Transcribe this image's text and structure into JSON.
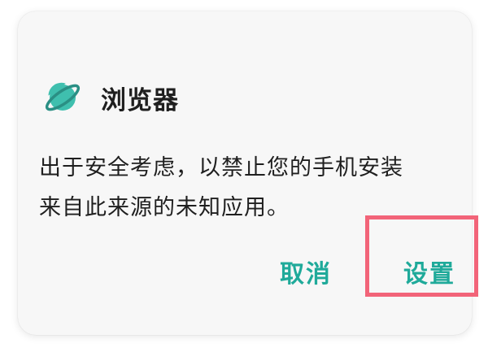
{
  "dialog": {
    "app_icon": "planet-icon",
    "app_name": "浏览器",
    "message_lines": [
      "出于安全考虑，以禁止您的手机安装",
      "来自此来源的未知应用。"
    ],
    "cancel_label": "取消",
    "settings_label": "设置"
  },
  "colors": {
    "accent": "#1faa9a",
    "icon_teal": "#3fbfae",
    "highlight": "#f26479",
    "dialog_bg": "#f7f7f7",
    "text": "#1f1f1f"
  }
}
